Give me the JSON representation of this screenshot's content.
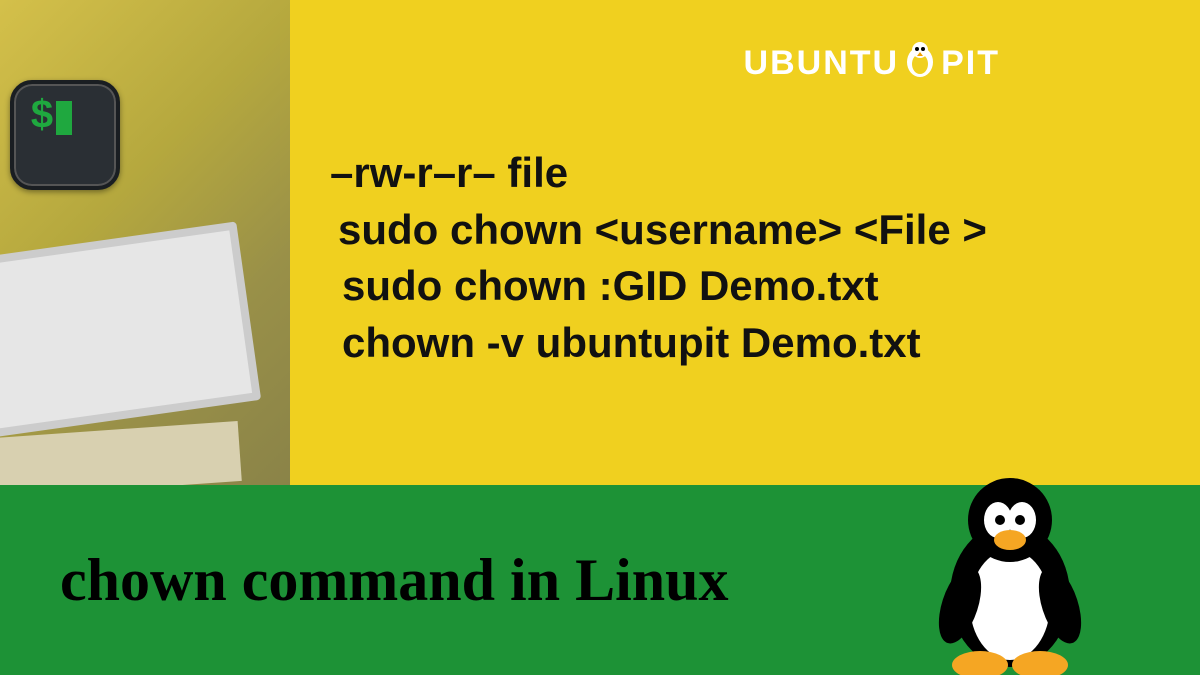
{
  "logo": {
    "part1": "UBUNTU",
    "part2": "PIT"
  },
  "terminal": {
    "prompt": "$"
  },
  "commands": {
    "line1": "–rw-r–r– file",
    "line2": "sudo chown <username> <File >",
    "line3": "sudo chown :GID Demo.txt",
    "line4": "chown -v ubuntupit Demo.txt"
  },
  "title": "chown command in Linux"
}
